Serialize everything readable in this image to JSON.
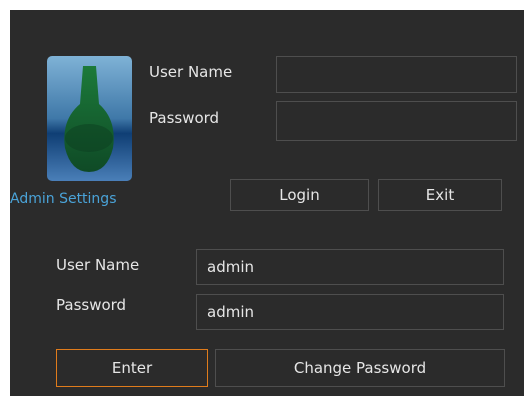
{
  "top_login": {
    "username_label": "User Name",
    "password_label": "Password",
    "username_value": "",
    "password_value": "",
    "login_label": "Login",
    "exit_label": "Exit"
  },
  "admin_link": "Admin Settings",
  "admin_form": {
    "username_label": "User Name",
    "password_label": "Password",
    "username_value": "admin",
    "password_value": "admin",
    "enter_label": "Enter",
    "change_password_label": "Change Password"
  },
  "colors": {
    "background": "#2b2b2b",
    "border": "#4e4e4e",
    "text": "#e6e6e6",
    "accent": "#e07c1c",
    "link": "#4aa3d8"
  },
  "icons": {
    "logo": "bottle-logo-icon"
  }
}
